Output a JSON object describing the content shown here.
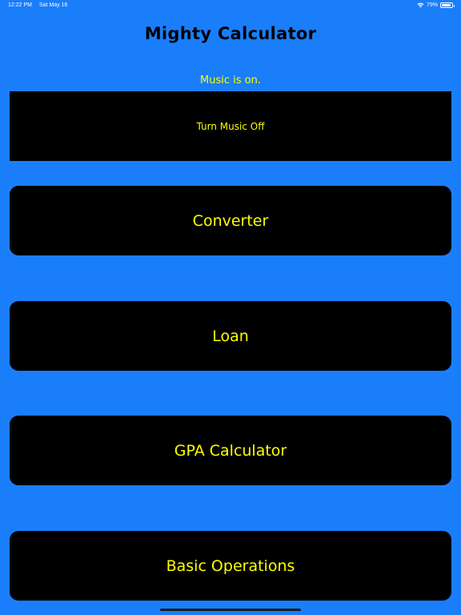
{
  "status_bar": {
    "time": "12:22 PM",
    "date": "Sat May 16",
    "battery": "79%"
  },
  "app": {
    "title": "Mighty Calculator",
    "music_status": "Music is on.",
    "music_toggle_label": "Turn Music Off"
  },
  "menu": {
    "items": [
      {
        "label": "Converter"
      },
      {
        "label": "Loan"
      },
      {
        "label": "GPA Calculator"
      },
      {
        "label": "Basic Operations"
      }
    ]
  },
  "colors": {
    "background": "#1a7efb",
    "button": "#000000",
    "button_text": "#ffff00",
    "title_text": "#000000"
  }
}
